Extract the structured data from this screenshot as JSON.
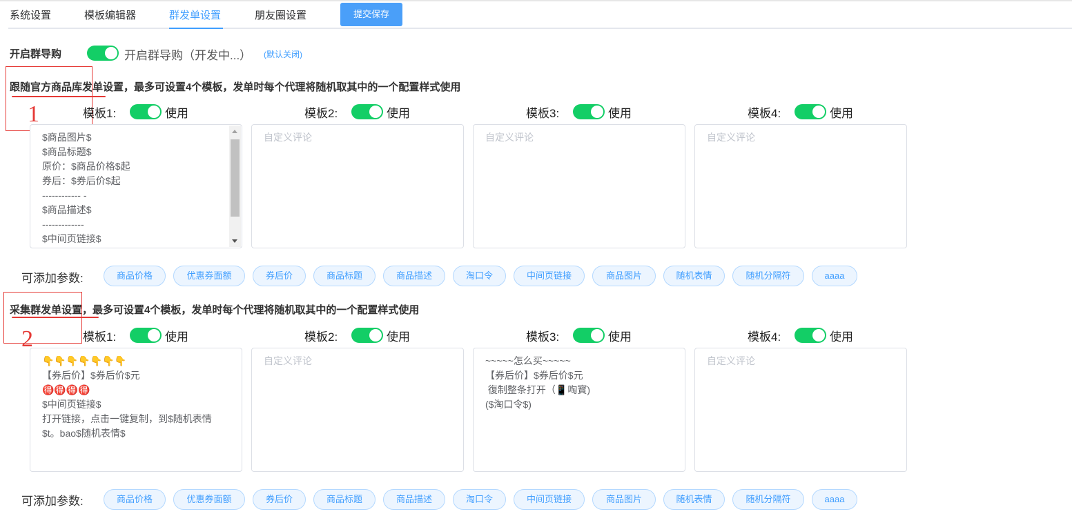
{
  "tabs": {
    "items": [
      "系统设置",
      "模板编辑器",
      "群发单设置",
      "朋友圈设置"
    ],
    "active": "群发单设置",
    "submit_label": "提交保存"
  },
  "group_buy": {
    "label": "开启群导购",
    "switch_on": true,
    "text": "开启群导购（开发中...）",
    "hint": "(默认关闭)"
  },
  "section1": {
    "title": "跟随官方商品库发单设置，最多可设置4个模板，发单时每个代理将随机取其中的一个配置样式使用",
    "annotation_number": "1",
    "templates": [
      {
        "label": "模板1:",
        "use_label": "使用",
        "enabled": true,
        "value": "$商品图片$\n$商品标题$\n原价：$商品价格$起\n券后：$券后价$起\n------------ -\n$商品描述$\n-------------\n$中间页链接$\n$随机表情$识别二维码，复制口令搜索",
        "placeholder": "自定义评论"
      },
      {
        "label": "模板2:",
        "use_label": "使用",
        "enabled": true,
        "value": "",
        "placeholder": "自定义评论"
      },
      {
        "label": "模板3:",
        "use_label": "使用",
        "enabled": true,
        "value": "",
        "placeholder": "自定义评论"
      },
      {
        "label": "模板4:",
        "use_label": "使用",
        "enabled": true,
        "value": "",
        "placeholder": "自定义评论"
      }
    ],
    "params_label": "可添加参数:",
    "params": [
      "商品价格",
      "优惠券面额",
      "券后价",
      "商品标题",
      "商品描述",
      "淘口令",
      "中间页链接",
      "商品图片",
      "随机表情",
      "随机分隔符",
      "aaaa"
    ]
  },
  "section2": {
    "title": "采集群发单设置，最多可设置4个模板，发单时每个代理将随机取其中的一个配置样式使用",
    "annotation_number": "2",
    "templates": [
      {
        "label": "模板1:",
        "use_label": "使用",
        "enabled": true,
        "value": "👇👇👇👇👇👇👇\n【券后价】$券后价$元\n🉐🉐🉐🉐\n$中间页链接$\n打开链接，点击一键复制，到$随机表情\n$t。bao$随机表情$",
        "placeholder": "自定义评论"
      },
      {
        "label": "模板2:",
        "use_label": "使用",
        "enabled": true,
        "value": "",
        "placeholder": "自定义评论"
      },
      {
        "label": "模板3:",
        "use_label": "使用",
        "enabled": true,
        "value": "~~~~~怎么买~~~~~\n【券后价】$券后价$元\n 復制整条打开（📱啕寳)\n($淘口令$)",
        "placeholder": "自定义评论"
      },
      {
        "label": "模板4:",
        "use_label": "使用",
        "enabled": true,
        "value": "",
        "placeholder": "自定义评论"
      }
    ],
    "params_label": "可添加参数:",
    "params": [
      "商品价格",
      "优惠券面额",
      "券后价",
      "商品标题",
      "商品描述",
      "淘口令",
      "中间页链接",
      "商品图片",
      "随机表情",
      "随机分隔符",
      "aaaa"
    ]
  },
  "colors": {
    "accent": "#409eff",
    "switch_on": "#13ce66",
    "annotation_red": "#e53935"
  }
}
